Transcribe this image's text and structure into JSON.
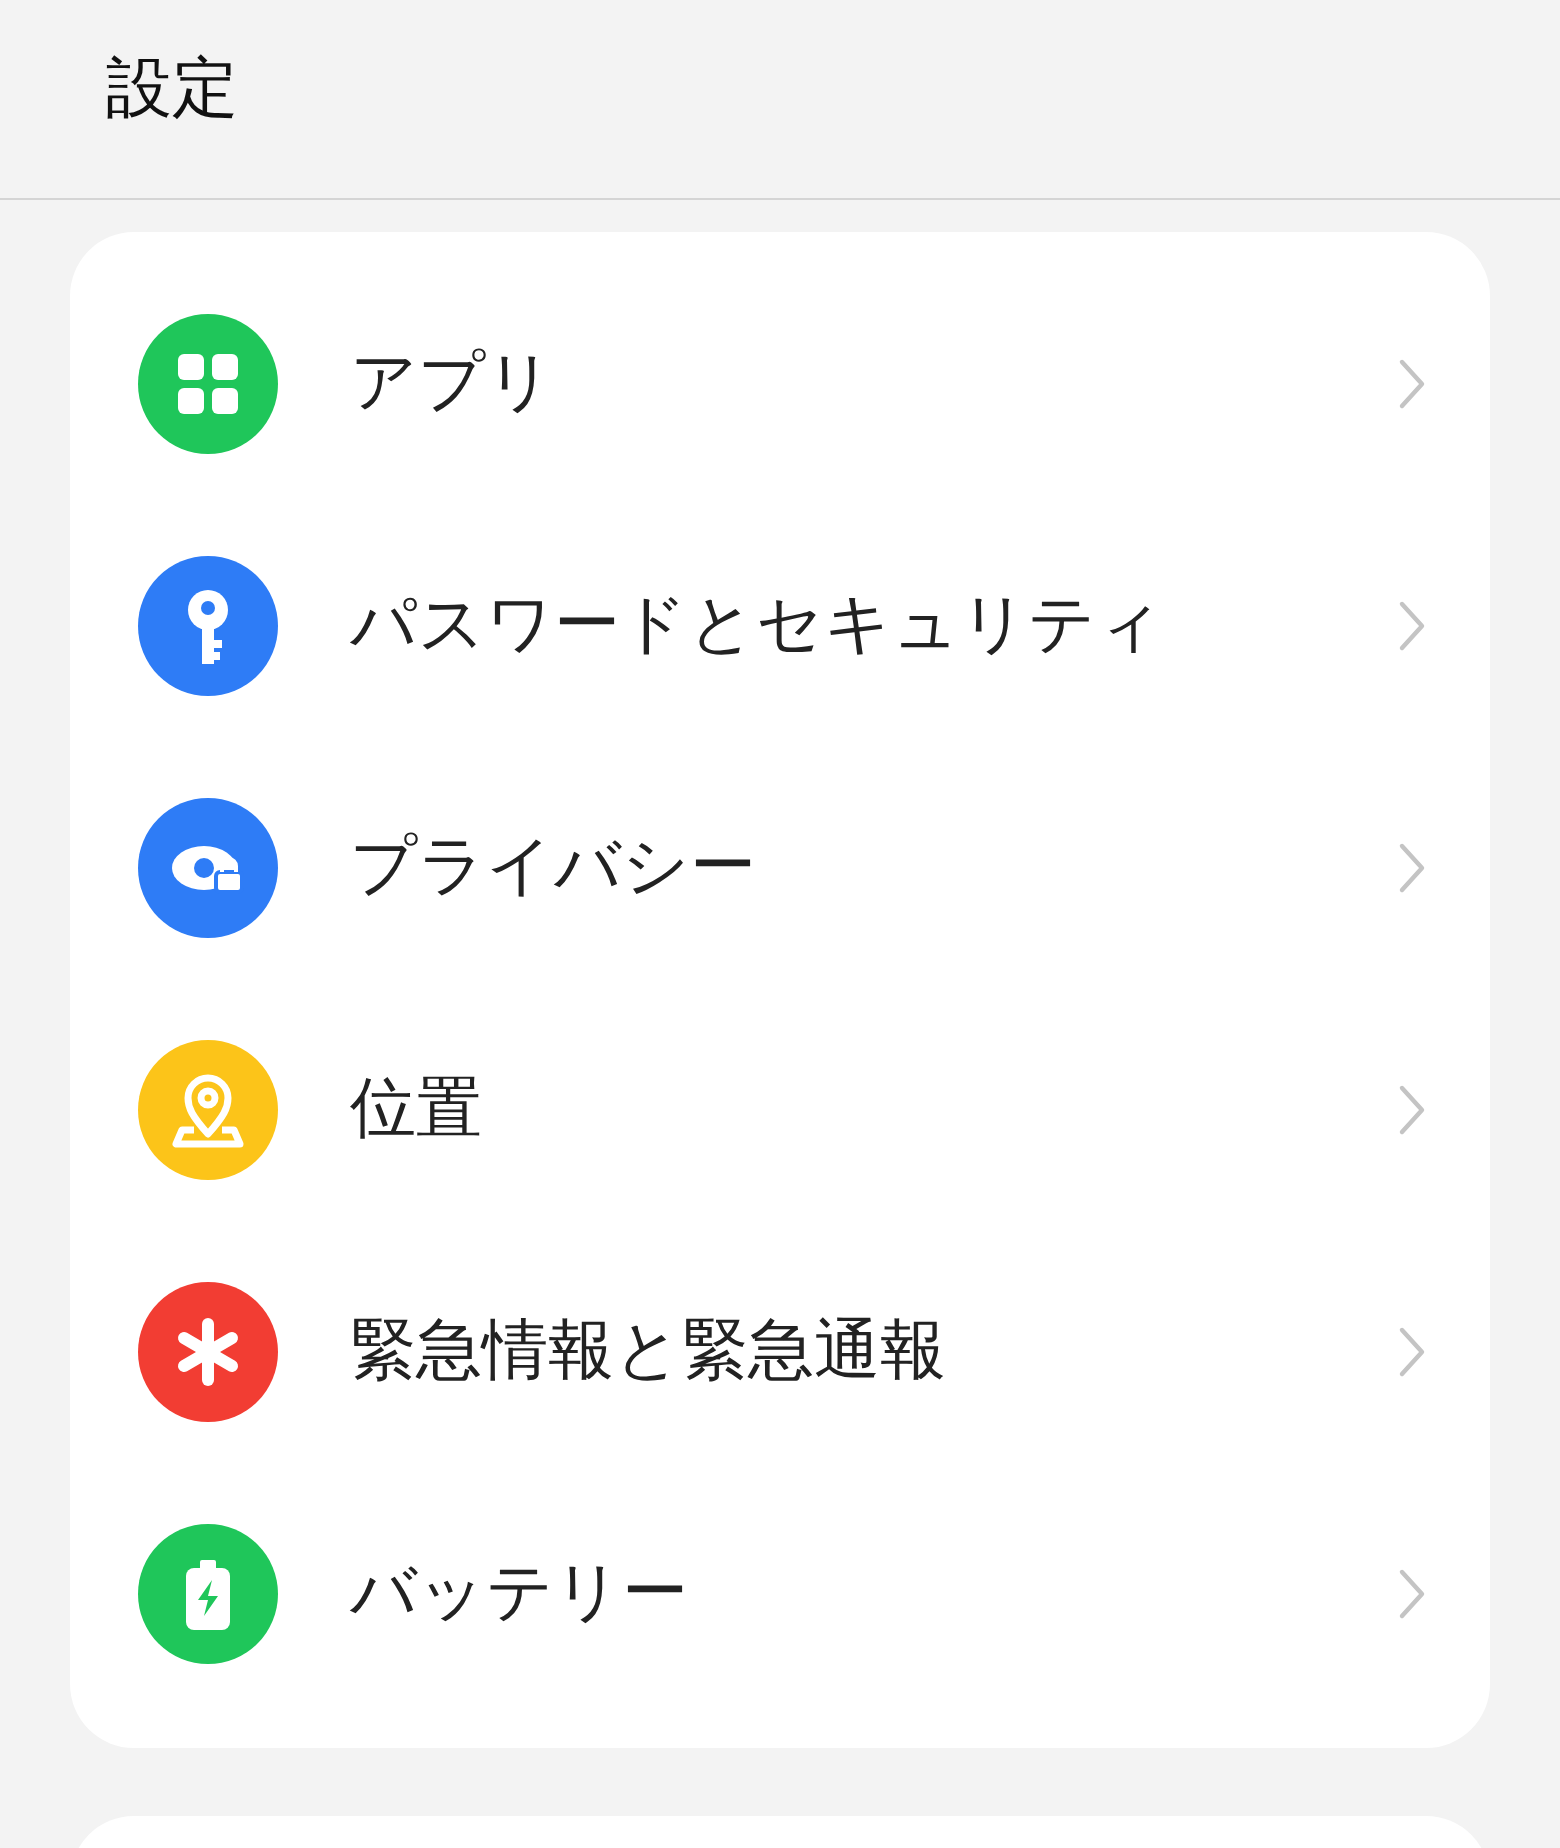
{
  "header": {
    "title": "設定"
  },
  "items": [
    {
      "label": "アプリ",
      "kind": "apps",
      "color": "#1fc65a"
    },
    {
      "label": "パスワードとセキュリティ",
      "kind": "key",
      "color": "#2e7cf6"
    },
    {
      "label": "プライバシー",
      "kind": "privacy",
      "color": "#2e7cf6"
    },
    {
      "label": "位置",
      "kind": "location",
      "color": "#fcc419"
    },
    {
      "label": "緊急情報と緊急通報",
      "kind": "emergency",
      "color": "#f23d33"
    },
    {
      "label": "バッテリー",
      "kind": "battery",
      "color": "#1fc65a"
    }
  ]
}
